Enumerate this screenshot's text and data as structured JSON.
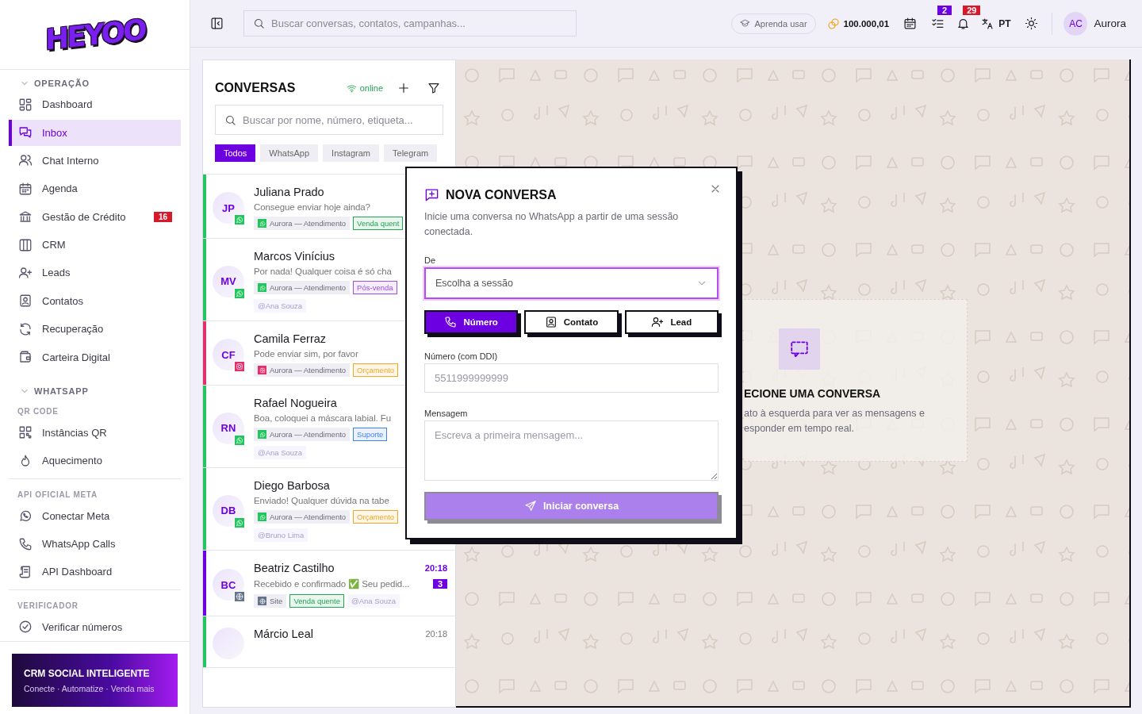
{
  "sidebar": {
    "logo": "HEYOO",
    "groups": [
      {
        "kind": "section",
        "title": "OPERAÇÃO",
        "expanded": true,
        "items": [
          {
            "label": "Dashboard",
            "selected": false
          },
          {
            "label": "Inbox",
            "selected": true
          },
          {
            "label": "Chat Interno",
            "selected": false
          },
          {
            "label": "Agenda",
            "selected": false
          },
          {
            "label": "Gestão de Crédito",
            "selected": false,
            "badge": "16"
          },
          {
            "label": "CRM",
            "selected": false
          },
          {
            "label": "Leads",
            "selected": false
          },
          {
            "label": "Contatos",
            "selected": false
          },
          {
            "label": "Recuperação",
            "selected": false
          },
          {
            "label": "Carteira Digital",
            "selected": false
          }
        ]
      },
      {
        "kind": "section",
        "title": "WHATSAPP",
        "expanded": true
      },
      {
        "kind": "group",
        "title": "QR CODE",
        "items": [
          {
            "label": "Instâncias QR",
            "selected": false
          },
          {
            "label": "Aquecimento",
            "selected": false
          }
        ]
      },
      {
        "kind": "group",
        "title": "API OFICIAL META",
        "items": [
          {
            "label": "Conectar Meta",
            "selected": false
          },
          {
            "label": "WhatsApp Calls",
            "selected": false
          },
          {
            "label": "API Dashboard",
            "selected": false
          }
        ]
      },
      {
        "kind": "group",
        "title": "VERIFICADOR",
        "items": [
          {
            "label": "Verificar números",
            "selected": false
          }
        ]
      }
    ],
    "promo": {
      "title": "CRM SOCIAL INTELIGENTE",
      "subtitle": "Conecte · Automatize · Venda mais"
    }
  },
  "topbar": {
    "search": {
      "placeholder": "Buscar conversas, contatos, campanhas..."
    },
    "help_button": "Aprenda usar",
    "credits": "100.000,01",
    "tasks_badge": "2",
    "notifications_badge": "29",
    "language": "PT",
    "user": {
      "initials": "AC",
      "name": "Aurora"
    }
  },
  "conversations": {
    "title": "CONVERSAS",
    "status": "online",
    "search": {
      "placeholder": "Buscar por nome, número, etiqueta..."
    },
    "filters": [
      {
        "label": "Todos",
        "selected": true
      },
      {
        "label": "WhatsApp",
        "selected": false
      },
      {
        "label": "Instagram",
        "selected": false
      },
      {
        "label": "Telegram",
        "selected": false
      }
    ],
    "items": [
      {
        "name": "Juliana Prado",
        "initials": "JP",
        "kind": "whatsapp",
        "color": "#22c55e",
        "preview": "Consegue enviar hoje ainda?",
        "source": "Aurora — Atendimento",
        "tags": [
          {
            "text": "Venda quent",
            "color": "#22a653"
          }
        ]
      },
      {
        "name": "Marcos Vinícius",
        "initials": "MV",
        "kind": "whatsapp",
        "color": "#22c55e",
        "preview": "Por nada! Qualquer coisa é só cha",
        "source": "Aurora — Atendimento",
        "tags": [
          {
            "text": "Pós-venda",
            "color": "#9b51e0"
          }
        ],
        "mention": "@Ana Souza"
      },
      {
        "name": "Camila Ferraz",
        "initials": "CF",
        "kind": "instagram",
        "color": "#e1306c",
        "preview": "Pode enviar sim, por favor",
        "source": "Aurora — Atendimento",
        "tags": [
          {
            "text": "Orçamento",
            "color": "#f5a623"
          }
        ]
      },
      {
        "name": "Rafael Nogueira",
        "initials": "RN",
        "kind": "whatsapp",
        "color": "#22c55e",
        "preview": "Boa, coloquei a máscara labial. Fu",
        "source": "Aurora — Atendimento",
        "tags": [
          {
            "text": "Suporte",
            "color": "#3b82f6"
          }
        ],
        "mention": "@Ana Souza"
      },
      {
        "name": "Diego Barbosa",
        "initials": "DB",
        "kind": "whatsapp",
        "color": "#22c55e",
        "preview": "Enviado! Qualquer dúvida na tabe",
        "source": "Aurora — Atendimento",
        "tags": [
          {
            "text": "Orçamento",
            "color": "#f5a623"
          }
        ],
        "mention": "@Bruno Lima"
      },
      {
        "name": "Beatriz Castilho",
        "initials": "BC",
        "kind": "site",
        "color": "#6d00e0",
        "time": "20:18",
        "unread": "3",
        "preview": "Recebido e confirmado ✅ Seu pedid...",
        "source": "Site",
        "tags": [
          {
            "text": "Venda quente",
            "color": "#22a653"
          }
        ],
        "mention": "@Ana Souza"
      },
      {
        "name": "Márcio Leal",
        "kind": "whatsapp",
        "color": "#22c55e",
        "time": "20:18"
      }
    ]
  },
  "empty_state": {
    "title": "ECIONE UMA CONVERSA",
    "lines": [
      "ato à esquerda para ver as mensagens e",
      "esponder em tempo real."
    ]
  },
  "modal": {
    "title": "NOVA CONVERSA",
    "description": "Inicie uma conversa no WhatsApp a partir de uma sessão conectada.",
    "from": {
      "label": "De",
      "placeholder": "Escolha a sessão"
    },
    "modes": [
      {
        "label": "Número",
        "selected": true
      },
      {
        "label": "Contato",
        "selected": false
      },
      {
        "label": "Lead",
        "selected": false
      }
    ],
    "number": {
      "label": "Número (com DDI)",
      "placeholder": "5511999999999"
    },
    "message": {
      "label": "Mensagem",
      "placeholder": "Escreva a primeira mensagem..."
    },
    "submit": {
      "label": "Iniciar conversa",
      "disabled": true
    }
  }
}
